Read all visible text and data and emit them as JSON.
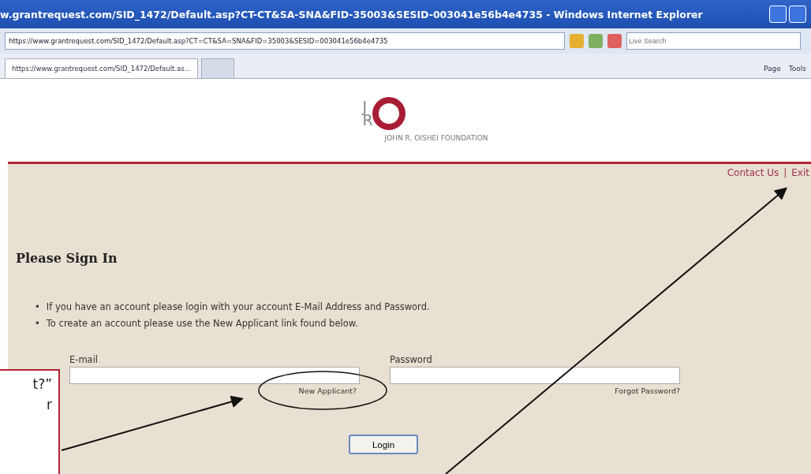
{
  "window": {
    "title": "w.grantrequest.com/SID_1472/Default.asp?CT-CT&SA-SNA&FID-35003&SESID-003041e56b4e4735 - Windows Internet Explorer"
  },
  "address_bar": {
    "value": "https://www.grantrequest.com/SID_1472/Default.asp?CT=CT&SA=SNA&FID=35003&SESID=003041e56b4e4735",
    "search_placeholder": "Live Search"
  },
  "tabs": [
    {
      "label": "https://www.grantrequest.com/SID_1472/Default.as...",
      "selected": true
    },
    {
      "selected": false
    }
  ],
  "command_bar": [
    "Page",
    "Tools"
  ],
  "logo": {
    "letters": [
      "J",
      "R"
    ],
    "name": "JOHN R. OISHEI FOUNDATION"
  },
  "top_links": [
    "Contact Us",
    "|",
    "Exit"
  ],
  "heading": "Please Sign In",
  "instructions": [
    {
      "bullet": "•",
      "text": "If you have an account please login with your account E-Mail Address and Password."
    },
    {
      "bullet": "•",
      "text": "To create an account please use the New Applicant link found below."
    }
  ],
  "email": {
    "label": "E-mail",
    "link": "New Applicant?"
  },
  "password": {
    "label": "Password",
    "link": "Forgot Password?"
  },
  "login_button": "Login",
  "callout": {
    "lines": [
      "t?”",
      "r"
    ]
  }
}
